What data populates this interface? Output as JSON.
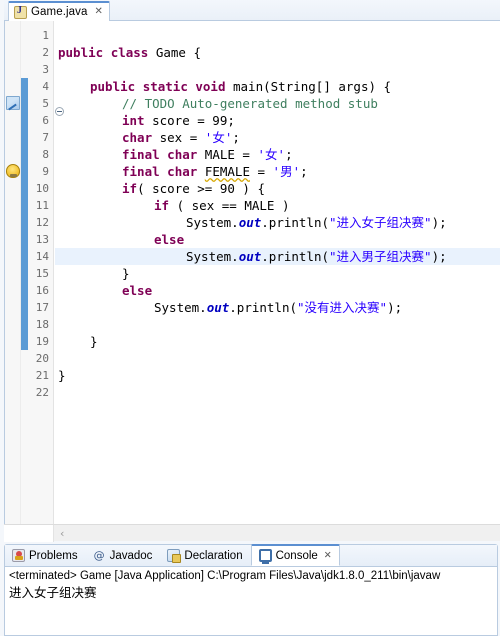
{
  "editor_tab": {
    "title": "Game.java",
    "close_label": "✕",
    "icon": "java-file-icon"
  },
  "gutter": {
    "line_numbers": [
      "1",
      "2",
      "3",
      "4",
      "5",
      "6",
      "7",
      "8",
      "9",
      "10",
      "11",
      "12",
      "13",
      "14",
      "15",
      "16",
      "17",
      "18",
      "19",
      "20",
      "21",
      "22"
    ],
    "fold_lines": [
      4
    ],
    "annotations": [
      {
        "line": 5,
        "type": "todo-marker-icon"
      },
      {
        "line": 9,
        "type": "warning-icon"
      }
    ]
  },
  "code": {
    "current_line": 14,
    "lines": [
      {
        "n": 1,
        "indent": 0,
        "tokens": []
      },
      {
        "n": 2,
        "indent": 0,
        "tokens": [
          {
            "t": "public",
            "c": "kw"
          },
          {
            "t": " ",
            "c": ""
          },
          {
            "t": "class",
            "c": "kw"
          },
          {
            "t": " Game {",
            "c": ""
          }
        ]
      },
      {
        "n": 3,
        "indent": 0,
        "tokens": []
      },
      {
        "n": 4,
        "indent": 1,
        "tokens": [
          {
            "t": "public",
            "c": "kw"
          },
          {
            "t": " ",
            "c": ""
          },
          {
            "t": "static",
            "c": "kw"
          },
          {
            "t": " ",
            "c": ""
          },
          {
            "t": "void",
            "c": "kw"
          },
          {
            "t": " main(String[] args) {",
            "c": ""
          }
        ]
      },
      {
        "n": 5,
        "indent": 2,
        "tokens": [
          {
            "t": "// TODO Auto-generated method stub",
            "c": "cmt"
          }
        ]
      },
      {
        "n": 6,
        "indent": 2,
        "tokens": [
          {
            "t": "int",
            "c": "kw"
          },
          {
            "t": " score = 99;",
            "c": ""
          }
        ]
      },
      {
        "n": 7,
        "indent": 2,
        "tokens": [
          {
            "t": "char",
            "c": "kw"
          },
          {
            "t": " sex = ",
            "c": ""
          },
          {
            "t": "'女'",
            "c": "str"
          },
          {
            "t": ";",
            "c": ""
          }
        ]
      },
      {
        "n": 8,
        "indent": 2,
        "tokens": [
          {
            "t": "final",
            "c": "kw"
          },
          {
            "t": " ",
            "c": ""
          },
          {
            "t": "char",
            "c": "kw"
          },
          {
            "t": " MALE = ",
            "c": ""
          },
          {
            "t": "'女'",
            "c": "str"
          },
          {
            "t": ";",
            "c": ""
          }
        ]
      },
      {
        "n": 9,
        "indent": 2,
        "tokens": [
          {
            "t": "final",
            "c": "kw"
          },
          {
            "t": " ",
            "c": ""
          },
          {
            "t": "char",
            "c": "kw"
          },
          {
            "t": " ",
            "c": ""
          },
          {
            "t": "FEMALE",
            "c": "warnu"
          },
          {
            "t": " = ",
            "c": ""
          },
          {
            "t": "'男'",
            "c": "str"
          },
          {
            "t": ";",
            "c": ""
          }
        ]
      },
      {
        "n": 10,
        "indent": 2,
        "tokens": [
          {
            "t": "if",
            "c": "kw"
          },
          {
            "t": "( score >= 90 ) {",
            "c": ""
          }
        ]
      },
      {
        "n": 11,
        "indent": 3,
        "tokens": [
          {
            "t": "if",
            "c": "kw"
          },
          {
            "t": " ( sex == MALE )",
            "c": ""
          }
        ]
      },
      {
        "n": 12,
        "indent": 4,
        "tokens": [
          {
            "t": "System.",
            "c": ""
          },
          {
            "t": "out",
            "c": "fld"
          },
          {
            "t": ".println(",
            "c": ""
          },
          {
            "t": "\"进入女子组决赛\"",
            "c": "str"
          },
          {
            "t": ");",
            "c": ""
          }
        ]
      },
      {
        "n": 13,
        "indent": 3,
        "tokens": [
          {
            "t": "else",
            "c": "kw"
          }
        ]
      },
      {
        "n": 14,
        "indent": 4,
        "tokens": [
          {
            "t": "System.",
            "c": ""
          },
          {
            "t": "out",
            "c": "fld"
          },
          {
            "t": ".println(",
            "c": ""
          },
          {
            "t": "\"进入男子组决赛\"",
            "c": "str"
          },
          {
            "t": ");",
            "c": ""
          }
        ]
      },
      {
        "n": 15,
        "indent": 2,
        "tokens": [
          {
            "t": "}",
            "c": ""
          }
        ]
      },
      {
        "n": 16,
        "indent": 2,
        "tokens": [
          {
            "t": "else",
            "c": "kw"
          }
        ]
      },
      {
        "n": 17,
        "indent": 3,
        "tokens": [
          {
            "t": "System.",
            "c": ""
          },
          {
            "t": "out",
            "c": "fld"
          },
          {
            "t": ".println(",
            "c": ""
          },
          {
            "t": "\"没有进入决赛\"",
            "c": "str"
          },
          {
            "t": ");",
            "c": ""
          }
        ]
      },
      {
        "n": 18,
        "indent": 0,
        "tokens": []
      },
      {
        "n": 19,
        "indent": 1,
        "tokens": [
          {
            "t": "}",
            "c": ""
          }
        ]
      },
      {
        "n": 20,
        "indent": 0,
        "tokens": []
      },
      {
        "n": 21,
        "indent": 0,
        "tokens": [
          {
            "t": "}",
            "c": ""
          }
        ]
      },
      {
        "n": 22,
        "indent": 0,
        "tokens": []
      }
    ]
  },
  "scrollbar": {
    "left_arrow": "‹"
  },
  "bottom_view": {
    "tabs": [
      {
        "label": "Problems",
        "icon": "problems-icon",
        "active": false,
        "closable": false
      },
      {
        "label": "Javadoc",
        "icon": "javadoc-icon",
        "active": false,
        "closable": false
      },
      {
        "label": "Declaration",
        "icon": "declaration-icon",
        "active": false,
        "closable": false
      },
      {
        "label": "Console",
        "icon": "console-icon",
        "active": true,
        "closable": true
      }
    ],
    "close_label": "✕",
    "console": {
      "header": "<terminated> Game [Java Application] C:\\Program Files\\Java\\jdk1.8.0_211\\bin\\javaw",
      "output": [
        "进入女子组决赛"
      ]
    }
  },
  "colors": {
    "keyword": "#7f0055",
    "string": "#2a00ff",
    "comment": "#3f7f5f",
    "field": "#0000c0",
    "current_line_bg": "#e9f2fd",
    "changebar": "#5b9bd5",
    "tab_accent": "#5b8fd1"
  }
}
